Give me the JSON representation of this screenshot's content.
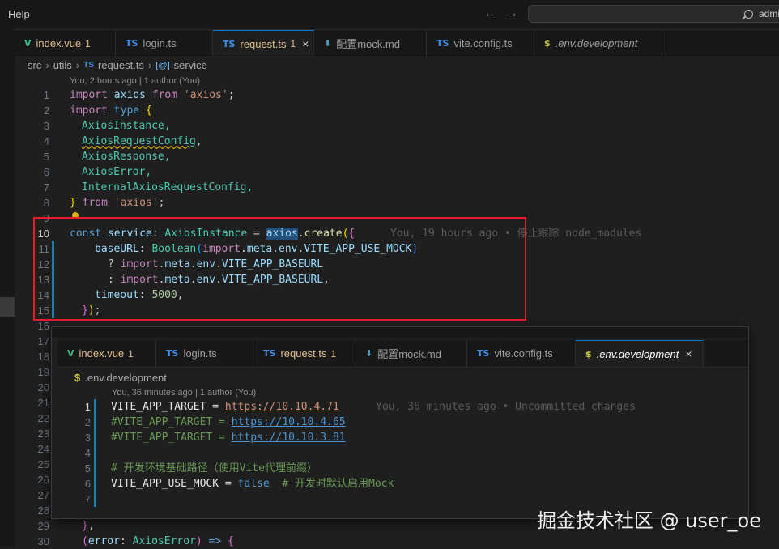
{
  "titlebar": {
    "menu_help": "Help",
    "search_text": "admi"
  },
  "main_tabs": [
    {
      "icon": "V",
      "label": "index.vue",
      "badge": "1"
    },
    {
      "icon": "TS",
      "label": "login.ts"
    },
    {
      "icon": "TS",
      "label": "request.ts",
      "badge": "1"
    },
    {
      "icon": "⬇",
      "label": "配置mock.md"
    },
    {
      "icon": "TS",
      "label": "vite.config.ts"
    },
    {
      "icon": "$",
      "label": ".env.development"
    }
  ],
  "breadcrumb": {
    "p1": "src",
    "p2": "utils",
    "p3_icon": "TS",
    "p3": "request.ts",
    "p4_icon": "[@]",
    "p4": "service"
  },
  "main_blame": "You, 2 hours ago | 1 author (You)",
  "main_lines": [
    "1",
    "2",
    "3",
    "4",
    "5",
    "6",
    "7",
    "8",
    "9",
    "10",
    "11",
    "12",
    "13",
    "14",
    "15",
    "16",
    "17",
    "18",
    "19",
    "20",
    "21",
    "22",
    "23",
    "24",
    "25",
    "26",
    "27",
    "28",
    "29",
    "30"
  ],
  "code": {
    "l1": [
      "import",
      " axios ",
      "from",
      " 'axios'",
      ";"
    ],
    "l2": [
      "import",
      " type",
      " ",
      "{"
    ],
    "l3": "AxiosInstance,",
    "l4a": "AxiosRequestConfig",
    "l4b": ",",
    "l5": "AxiosResponse,",
    "l6": "AxiosError,",
    "l7": "InternalAxiosRequestConfig,",
    "l8": [
      "}",
      " from",
      " 'axios'",
      ";"
    ],
    "l10": [
      "const",
      " service",
      ": ",
      "AxiosInstance",
      " = ",
      "axios",
      ".",
      "create",
      "(",
      "{"
    ],
    "l10_ghost": "You, 19 hours ago • 停止跟踪 node_modules",
    "l11": [
      "baseURL",
      ": ",
      "Boolean",
      "(",
      "import",
      ".",
      "meta",
      ".",
      "env",
      ".",
      "VITE_APP_USE_MOCK",
      ")"
    ],
    "l12": [
      "? ",
      "import",
      ".",
      "meta",
      ".",
      "env",
      ".",
      "VITE_APP_BASEURL"
    ],
    "l13": [
      ": ",
      "import",
      ".",
      "meta",
      ".",
      "env",
      ".",
      "VITE_APP_BASEURL",
      ","
    ],
    "l14": [
      "timeout",
      ": ",
      "5000",
      ","
    ],
    "l15": [
      "}",
      ")",
      ";"
    ],
    "l29": [
      "}",
      ","
    ],
    "l30": [
      "(",
      "error",
      ": ",
      "AxiosError",
      ")",
      " => ",
      "{"
    ]
  },
  "overlay": {
    "tabs": [
      {
        "icon": "V",
        "label": "index.vue",
        "badge": "1"
      },
      {
        "icon": "TS",
        "label": "login.ts"
      },
      {
        "icon": "TS",
        "label": "request.ts",
        "badge": "1"
      },
      {
        "icon": "⬇",
        "label": "配置mock.md"
      },
      {
        "icon": "TS",
        "label": "vite.config.ts"
      },
      {
        "icon": "$",
        "label": ".env.development"
      }
    ],
    "breadcrumb_icon": "$",
    "breadcrumb": ".env.development",
    "blame": "You, 36 minutes ago | 1 author (You)",
    "lines": [
      "1",
      "2",
      "3",
      "4",
      "5",
      "6",
      "7"
    ],
    "l1": [
      "VITE_APP_TARGET",
      " = ",
      "https://10.10.4.71"
    ],
    "l1_ghost": "You, 36 minutes ago • Uncommitted changes",
    "l2": [
      "#VITE_APP_TARGET = ",
      "https://10.10.4.65"
    ],
    "l3": [
      "#VITE_APP_TARGET = ",
      "https://10.10.3.81"
    ],
    "l5": "# 开发环境基础路径（使用Vite代理前缀）",
    "l6": [
      "VITE_APP_USE_MOCK",
      " = ",
      "false",
      "  # 开发时默认启用Mock"
    ]
  },
  "watermark": "掘金技术社区 @ user_oe",
  "close_glyph": "×"
}
